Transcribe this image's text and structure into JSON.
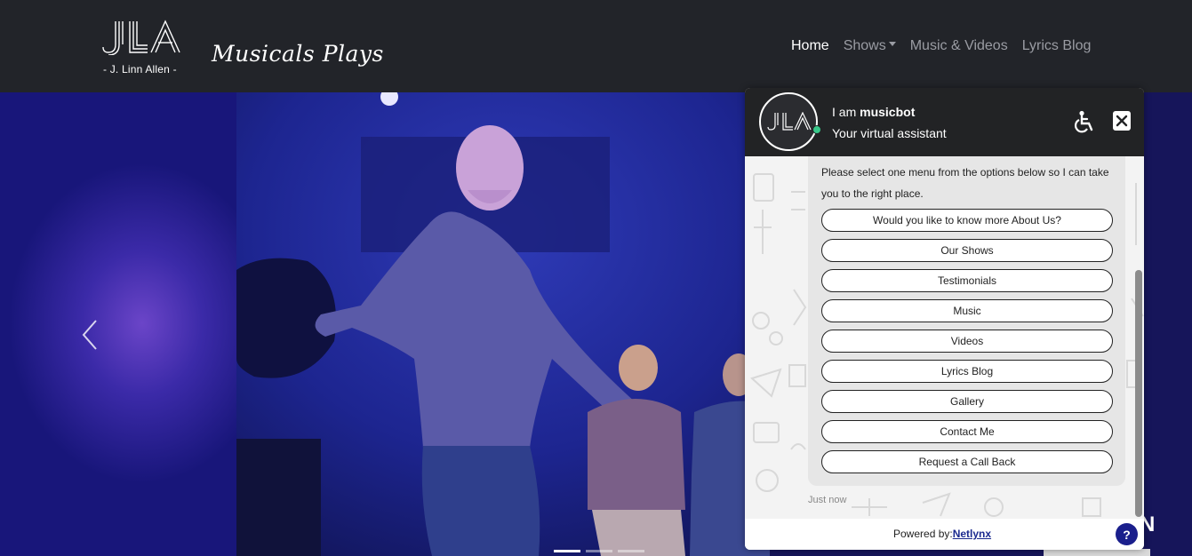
{
  "navbar": {
    "logo_letters": "JLA",
    "logo_sub": "- J. Linn Allen -",
    "tagline": "Musicals  Plays",
    "links": [
      {
        "label": "Home",
        "active": true
      },
      {
        "label": "Shows",
        "dropdown": true
      },
      {
        "label": "Music & Videos"
      },
      {
        "label": "Lyrics Blog"
      }
    ]
  },
  "hero": {
    "prev_icon": "chevron-left-icon",
    "indicators": [
      true,
      false,
      false
    ],
    "partial_letter": "N"
  },
  "chat": {
    "avatar_letters": "JLA",
    "line1_prefix": "I am ",
    "bot_name": "musicbot",
    "line2": "Your virtual assistant",
    "accessibility_icon": "wheelchair-icon",
    "close_icon": "close-icon",
    "prompt": "Please select one menu from the options below so I can take you to the right place.",
    "options": [
      "Would you like to know more About Us?",
      "Our Shows",
      "Testimonials",
      "Music",
      "Videos",
      "Lyrics Blog",
      "Gallery",
      "Contact Me",
      "Request a Call Back"
    ],
    "timestamp": "Just now",
    "powered_prefix": "Powered by:",
    "powered_link": "Netlynx",
    "help_label": "?"
  },
  "colors": {
    "navbar_bg": "#222429",
    "chat_header_bg": "#222325",
    "online": "#38c88a",
    "help_button": "#1a1f8c"
  }
}
